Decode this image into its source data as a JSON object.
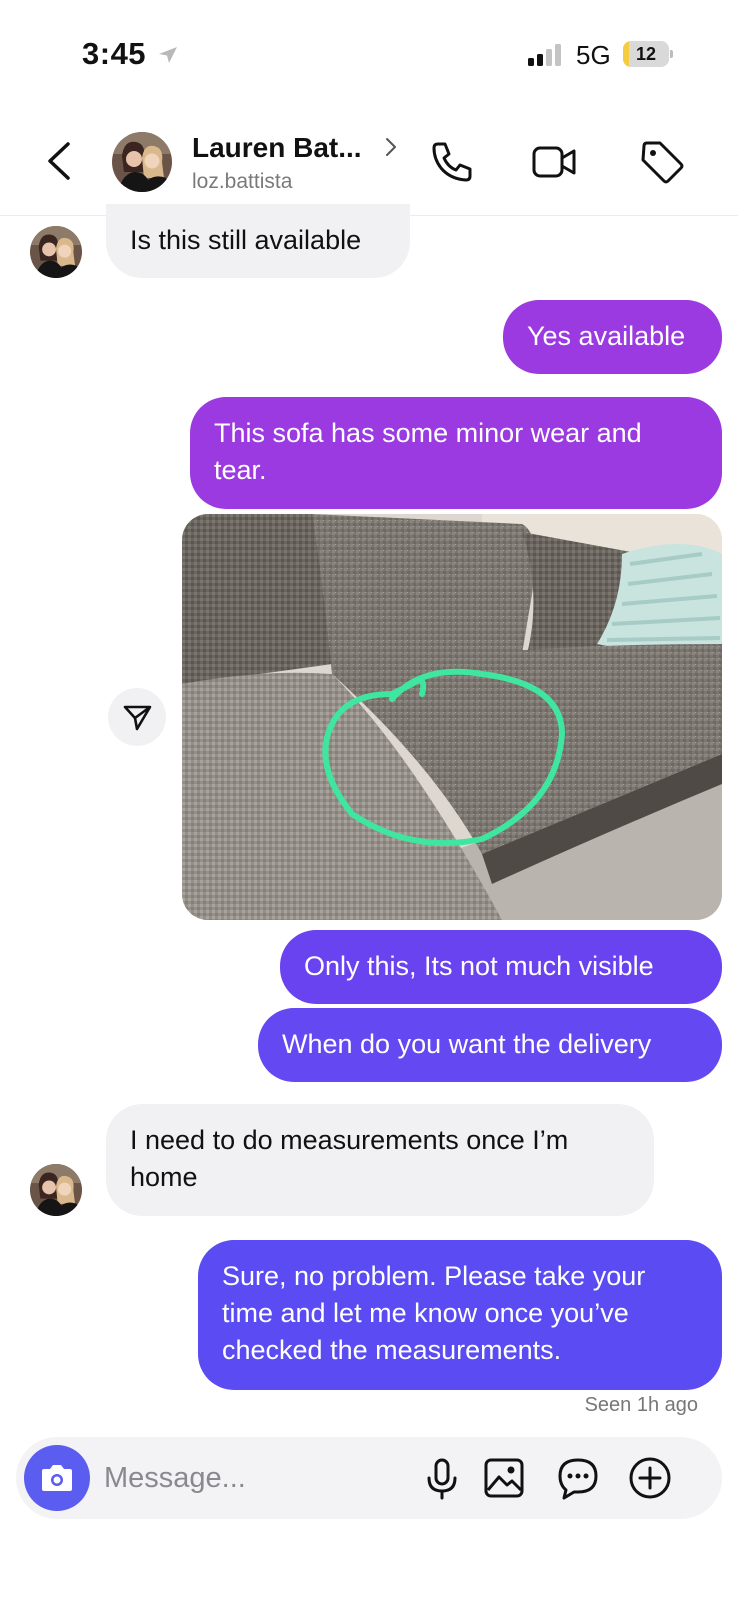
{
  "status_bar": {
    "time": "3:45",
    "network": "5G",
    "battery_level": "12",
    "battery_fraction": 0.12
  },
  "header": {
    "contact_name": "Lauren Bat...",
    "contact_handle": "loz.battista",
    "icons": [
      "chevron-left-icon",
      "chevron-right-icon",
      "phone-icon",
      "video-camera-icon",
      "tag-icon"
    ]
  },
  "messages": [
    {
      "direction": "incoming",
      "text": "Is this still available"
    },
    {
      "direction": "outgoing",
      "text": "Yes available"
    },
    {
      "direction": "outgoing",
      "text": "This sofa has some minor wear and tear."
    },
    {
      "direction": "outgoing",
      "type": "image",
      "description_icon": "sofa-photo"
    },
    {
      "direction": "outgoing",
      "text": "Only this, Its not much visible"
    },
    {
      "direction": "outgoing",
      "text": "When do you want the delivery"
    },
    {
      "direction": "incoming",
      "text": "I need to do measurements once I’m home"
    },
    {
      "direction": "outgoing",
      "text": "Sure, no problem. Please take your time and let me know once you’ve checked the measurements."
    }
  ],
  "seen_status": "Seen 1h ago",
  "composer": {
    "placeholder": "Message...",
    "icons": [
      "camera-icon",
      "microphone-icon",
      "image-icon",
      "sticker-icon",
      "plus-icon"
    ]
  },
  "colors": {
    "bubble_purple": "#9b3ae0",
    "bubble_violet": "#6a43f0",
    "bubble_indigo": "#5a4cf2",
    "bubble_incoming": "#f1f1f3",
    "camera_button": "#5b5cf0"
  }
}
